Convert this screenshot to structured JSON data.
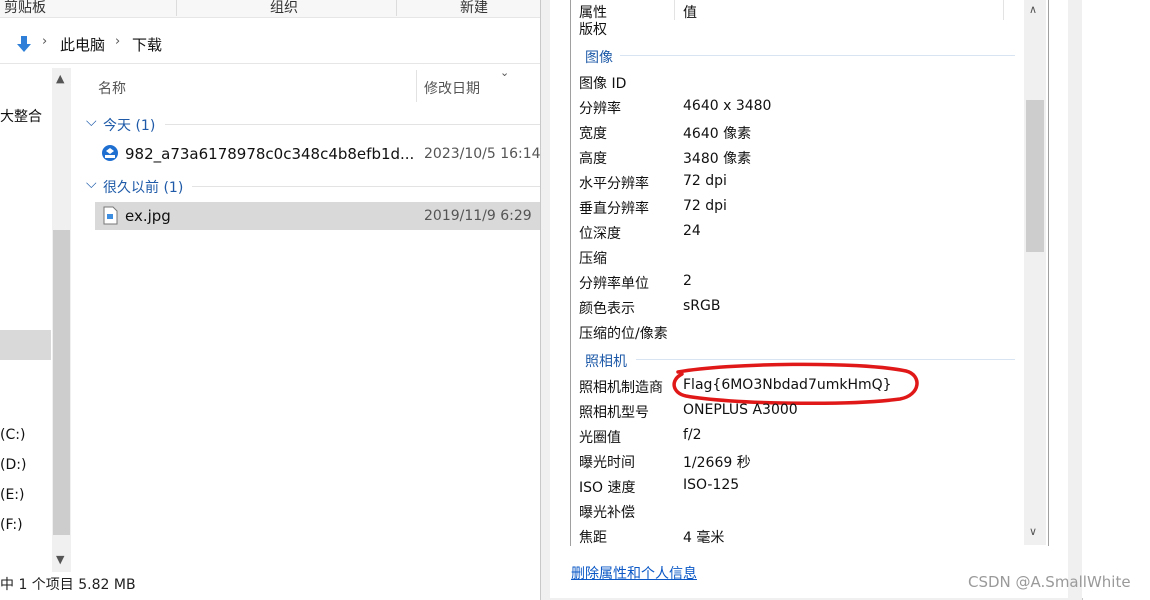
{
  "ribbon": {
    "groups": [
      "剪贴板",
      "组织",
      "新建"
    ]
  },
  "address": {
    "path": [
      "此电脑",
      "下载"
    ]
  },
  "nav": {
    "items": [
      "大整合",
      "(C:)",
      "(D:)",
      "(E:)",
      "(F:)"
    ]
  },
  "file_list": {
    "columns": [
      "名称",
      "修改日期"
    ],
    "groups": [
      {
        "label": "今天 (1)",
        "files": [
          {
            "name": "982_a73a6178978c0c348c4b8efb1d...",
            "date": "2023/10/5 16:14"
          }
        ]
      },
      {
        "label": "很久以前 (1)",
        "files": [
          {
            "name": "ex.jpg",
            "date": "2019/11/9 6:29"
          }
        ]
      }
    ]
  },
  "status_bar": {
    "text": "中 1 个项目  5.82 MB"
  },
  "properties": {
    "header": {
      "key": "属性",
      "value": "值"
    },
    "top_row": {
      "key": "版权",
      "value": ""
    },
    "sections": [
      {
        "title": "图像",
        "rows": [
          {
            "key": "图像 ID",
            "value": ""
          },
          {
            "key": "分辨率",
            "value": "4640 x 3480"
          },
          {
            "key": "宽度",
            "value": "4640 像素"
          },
          {
            "key": "高度",
            "value": "3480 像素"
          },
          {
            "key": "水平分辨率",
            "value": "72 dpi"
          },
          {
            "key": "垂直分辨率",
            "value": "72 dpi"
          },
          {
            "key": "位深度",
            "value": "24"
          },
          {
            "key": "压缩",
            "value": ""
          },
          {
            "key": "分辨率单位",
            "value": "2"
          },
          {
            "key": "颜色表示",
            "value": "sRGB"
          },
          {
            "key": "压缩的位/像素",
            "value": ""
          }
        ]
      },
      {
        "title": "照相机",
        "rows": [
          {
            "key": "照相机制造商",
            "value": "Flag{6MO3Nbdad7umkHmQ}"
          },
          {
            "key": "照相机型号",
            "value": "ONEPLUS A3000"
          },
          {
            "key": "光圈值",
            "value": "f/2"
          },
          {
            "key": "曝光时间",
            "value": "1/2669 秒"
          },
          {
            "key": "ISO 速度",
            "value": "ISO-125"
          },
          {
            "key": "曝光补偿",
            "value": ""
          },
          {
            "key": "焦距",
            "value": "4 毫米"
          }
        ]
      }
    ],
    "remove_link": "删除属性和个人信息"
  },
  "watermark": "CSDN @A.SmallWhite",
  "annotation_color": "#e01818"
}
